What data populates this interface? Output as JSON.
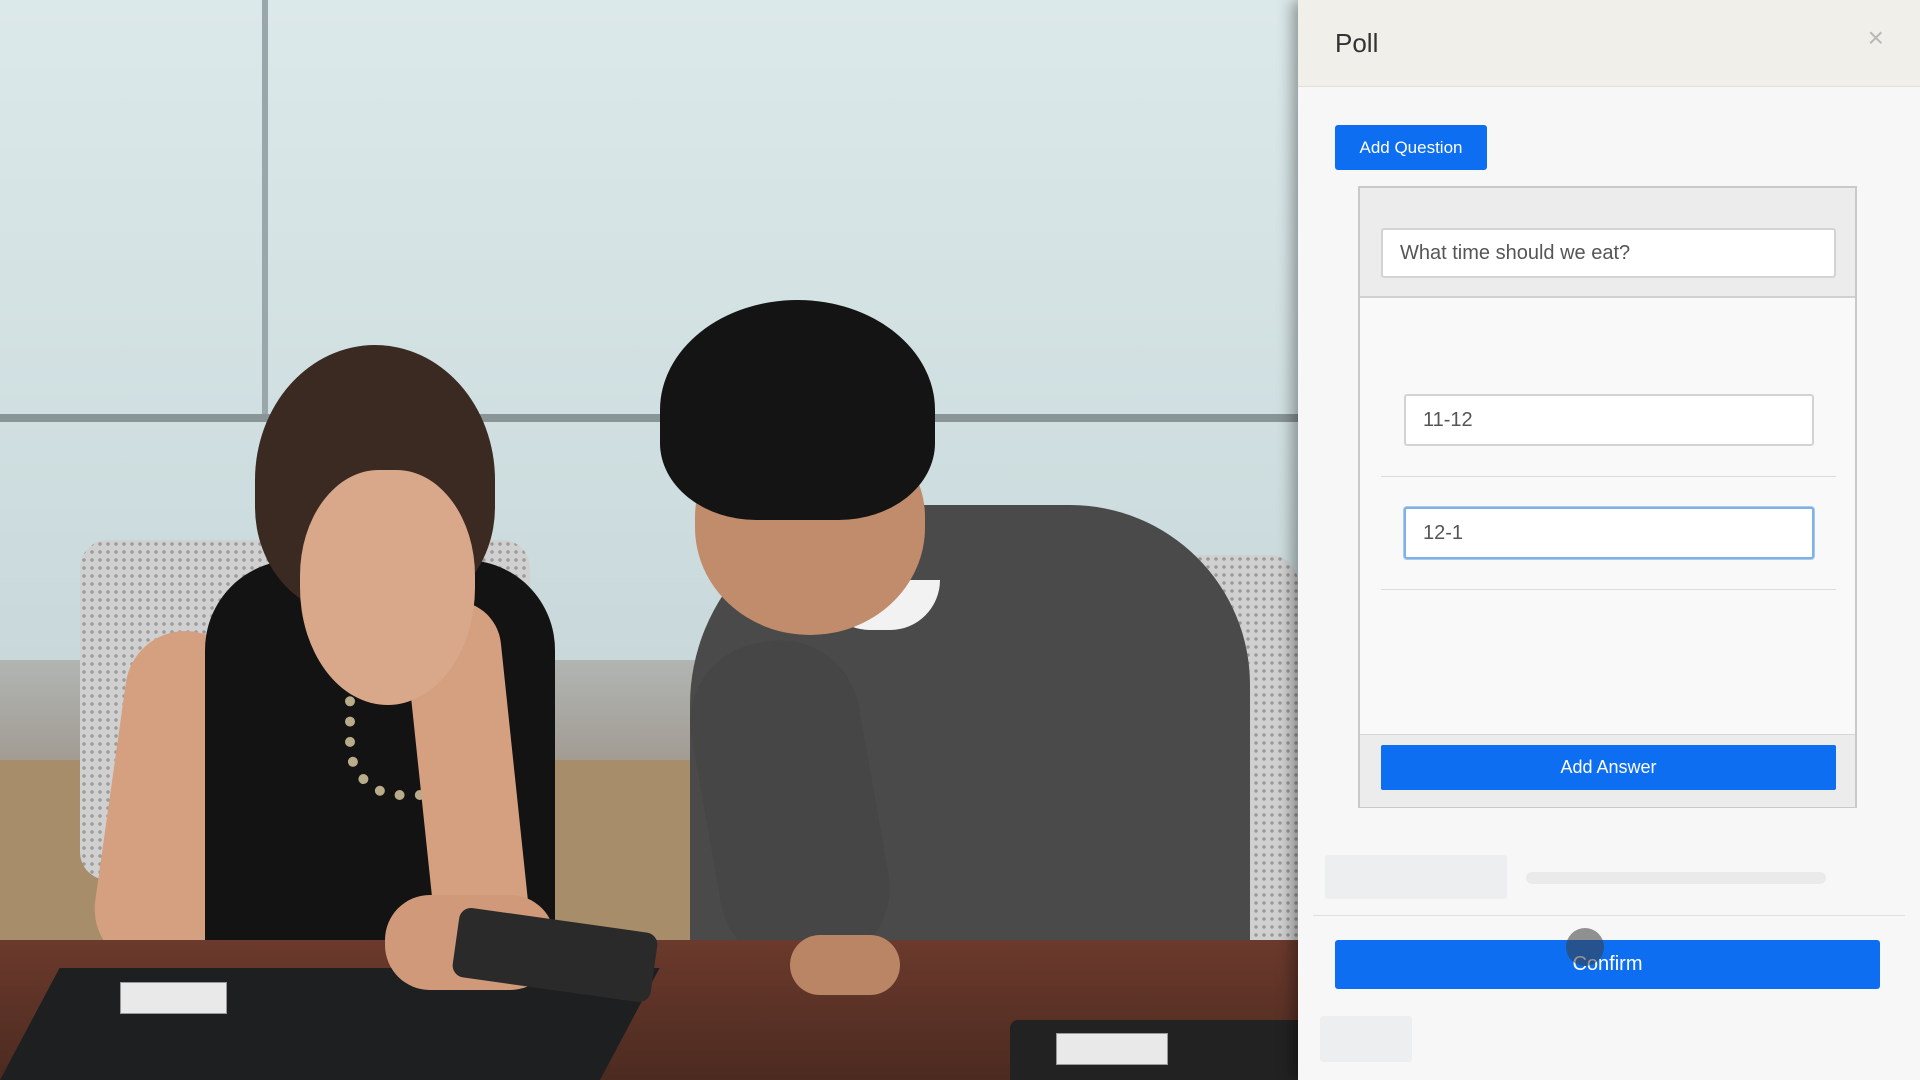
{
  "panel": {
    "title": "Poll",
    "close_glyph": "×",
    "add_question_label": "Add Question",
    "question": {
      "value": "What time should we eat?"
    },
    "answers": [
      {
        "value": "11-12"
      },
      {
        "value": "12-1"
      }
    ],
    "add_answer_label": "Add Answer",
    "confirm_label": "Confirm"
  },
  "colors": {
    "primary": "#0d6ef1",
    "panel_bg": "#f7f7f7",
    "header_bg": "#f1efe9"
  },
  "icons": {
    "close": "close-icon"
  }
}
